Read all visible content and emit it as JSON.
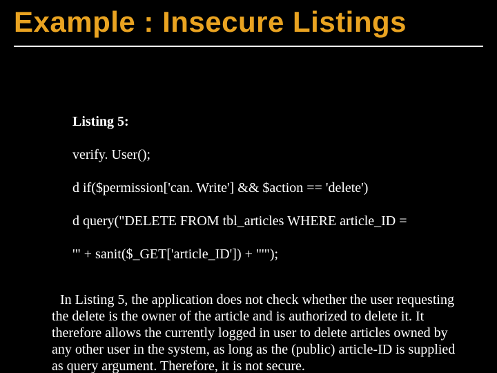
{
  "title": "Example : Insecure Listings",
  "listing": {
    "label": "Listing 5:",
    "line1": "verify. User();",
    "line2": "d if($permission['can. Write'] && $action == 'delete')",
    "line3": "d query(\"DELETE FROM tbl_articles WHERE article_ID =",
    "line4": "'\" + sanit($_GET['article_ID']) + \"'\");"
  },
  "paragraph": "In Listing 5, the application does not check whether the user requesting the delete is the owner of the article and is authorized to delete it. It therefore allows the currently logged in user to delete articles owned by any other user in the system, as long as the (public) article-ID is supplied as query argument. Therefore, it is not secure."
}
